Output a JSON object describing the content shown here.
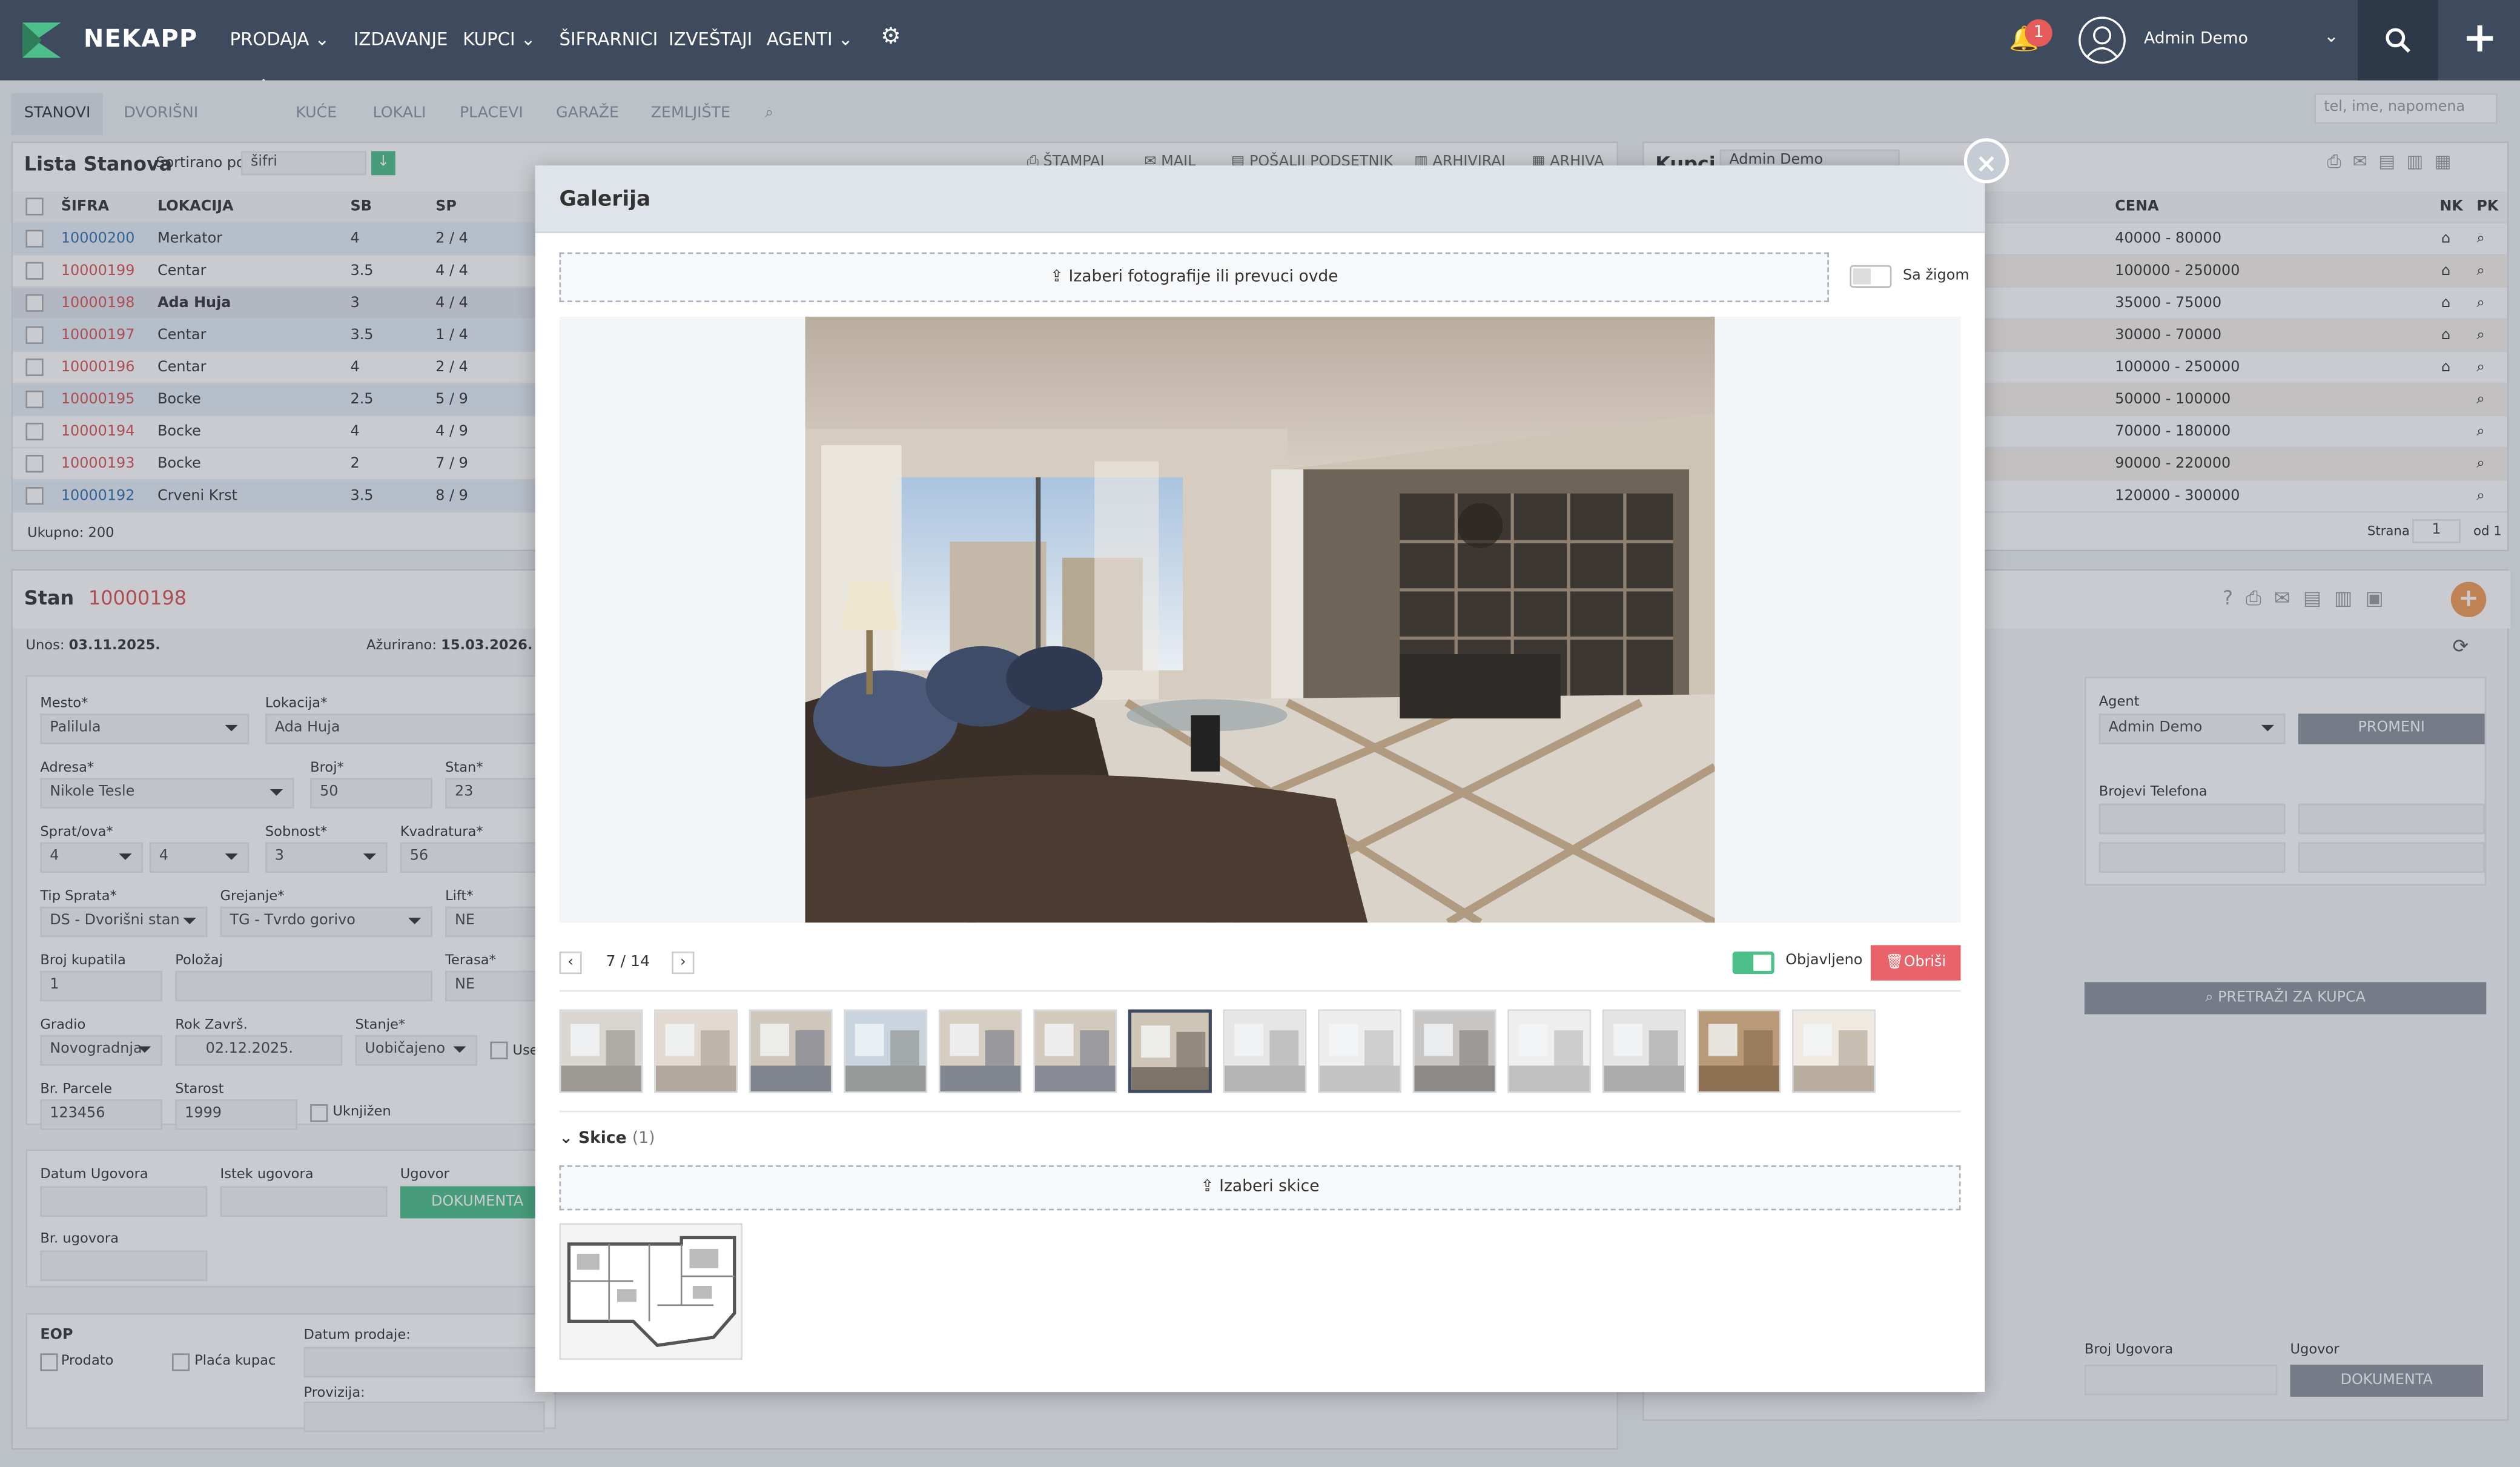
{
  "nav": {
    "brand": "NEKAPP",
    "items": [
      "PRODAJA",
      "IZDAVANJE",
      "KUPCI",
      "ŠIFRARNICI",
      "IZVEŠTAJI",
      "AGENTI"
    ],
    "notification_count": "1",
    "user": "Admin Demo"
  },
  "tabs": [
    "STANOVI",
    "DVORIŠNI STANOVI",
    "KUĆE",
    "LOKALI",
    "PLACEVI",
    "GARAŽE",
    "ZEMLJIŠTE"
  ],
  "global_search_placeholder": "tel, ime, napomena",
  "list": {
    "title": "Lista Stanova",
    "sort_label": "Sortirano po:",
    "sort_value": "šifri",
    "actions": [
      "ŠTAMPAJ",
      "MAIL",
      "POŠALJI PODSETNIK",
      "ARHIVIRAJ",
      "ARHIVA"
    ],
    "columns": [
      "ŠIFRA",
      "LOKACIJA",
      "SB",
      "SP"
    ],
    "rows": [
      {
        "sifra": "10000200",
        "lokacija": "Merkator",
        "sb": "4",
        "sp": "2 / 4",
        "color": "blue"
      },
      {
        "sifra": "10000199",
        "lokacija": "Centar",
        "sb": "3.5",
        "sp": "4 / 4",
        "color": "red"
      },
      {
        "sifra": "10000198",
        "lokacija": "Ada Huja",
        "sb": "3",
        "sp": "4 / 4",
        "color": "red"
      },
      {
        "sifra": "10000197",
        "lokacija": "Centar",
        "sb": "3.5",
        "sp": "1 / 4",
        "color": "red"
      },
      {
        "sifra": "10000196",
        "lokacija": "Centar",
        "sb": "4",
        "sp": "2 / 4",
        "color": "red"
      },
      {
        "sifra": "10000195",
        "lokacija": "Bocke",
        "sb": "2.5",
        "sp": "5 / 9",
        "color": "red"
      },
      {
        "sifra": "10000194",
        "lokacija": "Bocke",
        "sb": "4",
        "sp": "4 / 9",
        "color": "red"
      },
      {
        "sifra": "10000193",
        "lokacija": "Bocke",
        "sb": "2",
        "sp": "7 / 9",
        "color": "red"
      },
      {
        "sifra": "10000192",
        "lokacija": "Crveni Krst",
        "sb": "3.5",
        "sp": "8 / 9",
        "color": "blue"
      }
    ],
    "total": "Ukupno: 200"
  },
  "kupci": {
    "title": "Kupci",
    "agent": "Admin Demo",
    "columns": [
      "CENA",
      "NK",
      "PK"
    ],
    "prices": [
      "40000 - 80000",
      "100000 - 250000",
      "35000 - 75000",
      "30000 - 70000",
      "100000 - 250000",
      "50000 - 100000",
      "70000 - 180000",
      "90000 - 220000",
      "120000 - 300000"
    ],
    "pager_label": "Strana",
    "pager_value": "1",
    "pager_of": "od 1"
  },
  "stan": {
    "title": "Stan",
    "code": "10000198",
    "unos_label": "Unos:",
    "unos": "03.11.2025.",
    "azurirano_label": "Ažurirano:",
    "azurirano": "15.03.2026.",
    "mesto_label": "Mesto*",
    "mesto": "Palilula",
    "lokacija_label": "Lokacija*",
    "lokacija": "Ada Huja",
    "adresa_label": "Adresa*",
    "adresa": "Nikole Tesle",
    "broj_label": "Broj*",
    "broj": "50",
    "stan_label": "Stan*",
    "stan_val": "23",
    "sprat_label": "Sprat/ova*",
    "sprat1": "4",
    "sprat2": "4",
    "sobnost_label": "Sobnost*",
    "sobnost": "3",
    "kvadratura_label": "Kvadratura*",
    "kvadratura": "56",
    "tip_label": "Tip Sprata*",
    "tip": "DS - Dvorišni stan",
    "grejanje_label": "Grejanje*",
    "grejanje": "TG - Tvrdo gorivo",
    "lift_label": "Lift*",
    "lift": "NE",
    "kupatila_label": "Broj kupatila",
    "kupatila": "1",
    "polozaj_label": "Položaj",
    "terasa_label": "Terasa*",
    "terasa": "NE",
    "gradio_label": "Gradio",
    "gradio": "Novogradnja",
    "rok_label": "Rok Završ.",
    "rok": "02.12.2025.",
    "stanje_label": "Stanje*",
    "stanje": "Uobičajeno",
    "use_label": "Use",
    "parcela_label": "Br. Parcele",
    "parcela": "123456",
    "starost_label": "Starost",
    "starost": "1999",
    "uknjizen_label": "Uknjižen",
    "datum_ugovora": "Datum Ugovora",
    "istek_ugovora": "Istek ugovora",
    "ugovor": "Ugovor",
    "dokumenta": "DOKUMENTA",
    "br_ugovora": "Br. ugovora",
    "eop": "EOP",
    "prodato": "Prodato",
    "placa_kupac": "Plaća kupac",
    "datum_prodaje": "Datum prodaje:",
    "provizija": "Provizija:"
  },
  "right": {
    "agent_label": "Agent",
    "agent": "Admin Demo",
    "promeni": "PROMENI",
    "telefoni": "Brojevi Telefona",
    "pretrazi": "PRETRAŽI ZA KUPCA",
    "broj_ugovora": "Broj Ugovora",
    "ugovor": "Ugovor",
    "dokumenta": "DOKUMENTA"
  },
  "gallery": {
    "title": "Galerija",
    "upload": "Izaberi fotografije ili prevuci ovde",
    "watermark": "Sa žigom",
    "counter": "7 / 14",
    "published": "Objavljeno",
    "delete": "Obriši",
    "sketches_title": "Skice",
    "sketches_count": "(1)",
    "upload_sketches": "Izaberi skice"
  },
  "colors": {
    "nav": "#3e4b5e",
    "accent_green": "#4cbf8a",
    "danger": "#e8636a",
    "orange": "#f29a54"
  }
}
